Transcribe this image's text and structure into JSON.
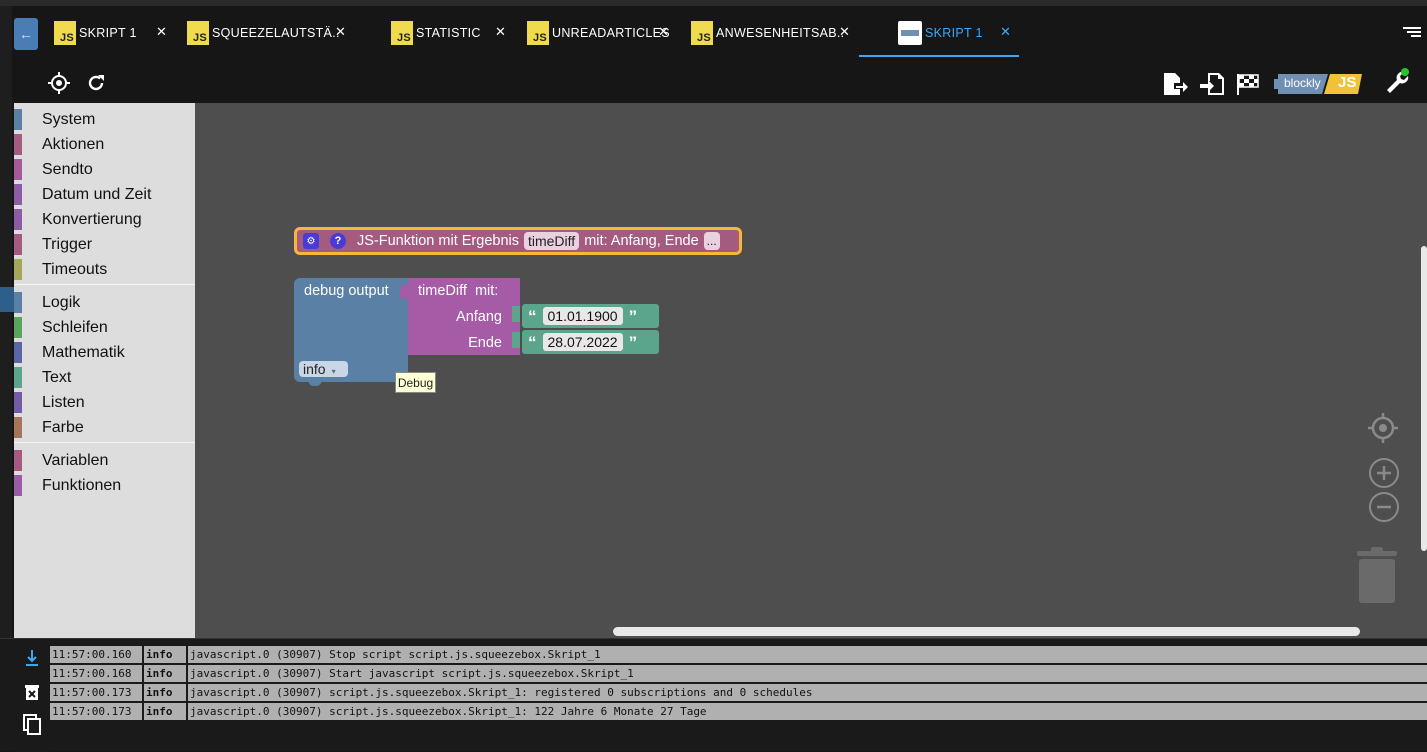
{
  "tabs": [
    {
      "label": "SKRIPT 1",
      "icon": "js-icon",
      "close": "✕"
    },
    {
      "label": "SQUEEZELAUTSTÄ..",
      "icon": "js-icon",
      "close": "✕"
    },
    {
      "label": "STATISTIC",
      "icon": "js-icon",
      "close": "✕"
    },
    {
      "label": "UNREADARTICLES",
      "icon": "js-icon",
      "close": "✕"
    },
    {
      "label": "ANWESENHEITSAB..",
      "icon": "js-icon",
      "close": "✕"
    },
    {
      "label": "SKRIPT 1",
      "icon": "blockly-icon",
      "close": "✕",
      "active": true
    }
  ],
  "js_badge": "JS",
  "toolbar": {
    "blockly_label": "blockly",
    "js_label": "JS"
  },
  "categories": [
    {
      "label": "System",
      "color": "#5b80a5"
    },
    {
      "label": "Aktionen",
      "color": "#a55b80"
    },
    {
      "label": "Sendto",
      "color": "#a55b99"
    },
    {
      "label": "Datum und Zeit",
      "color": "#8e5ba5"
    },
    {
      "label": "Konvertierung",
      "color": "#8e5ba5"
    },
    {
      "label": "Trigger",
      "color": "#a55b80"
    },
    {
      "label": "Timeouts",
      "color": "#a5a55b"
    },
    {
      "label": "Logik",
      "color": "#5b80a5"
    },
    {
      "label": "Schleifen",
      "color": "#5ba55b"
    },
    {
      "label": "Mathematik",
      "color": "#5b67a5"
    },
    {
      "label": "Text",
      "color": "#5ba58c"
    },
    {
      "label": "Listen",
      "color": "#745ba5"
    },
    {
      "label": "Farbe",
      "color": "#a5745b"
    },
    {
      "label": "Variablen",
      "color": "#a55b80"
    },
    {
      "label": "Funktionen",
      "color": "#995ba5"
    }
  ],
  "function_block": {
    "gear": "⚙",
    "help": "?",
    "label": "JS-Funktion mit Ergebnis",
    "name": "timeDiff",
    "params": "mit: Anfang, Ende",
    "more": "..."
  },
  "debug_block": {
    "label": "debug output",
    "level": "info",
    "arrow": "▾",
    "tooltip": "Debug"
  },
  "call_block": {
    "name": "timeDiff",
    "mit": "mit:",
    "args": [
      {
        "label": "Anfang",
        "value": "01.01.1900"
      },
      {
        "label": "Ende",
        "value": "28.07.2022"
      }
    ],
    "open_quote": "“",
    "close_quote": "”"
  },
  "log": [
    {
      "time": "11:57:00.160",
      "level": "info",
      "message": "javascript.0 (30907) Stop script script.js.squeezebox.Skript_1"
    },
    {
      "time": "11:57:00.168",
      "level": "info",
      "message": "javascript.0 (30907) Start javascript script.js.squeezebox.Skript_1"
    },
    {
      "time": "11:57:00.173",
      "level": "info",
      "message": "javascript.0 (30907) script.js.squeezebox.Skript_1: registered 0 subscriptions and 0 schedules"
    },
    {
      "time": "11:57:00.173",
      "level": "info",
      "message": "javascript.0 (30907) script.js.squeezebox.Skript_1: 122 Jahre 6 Monate 27 Tage"
    }
  ]
}
